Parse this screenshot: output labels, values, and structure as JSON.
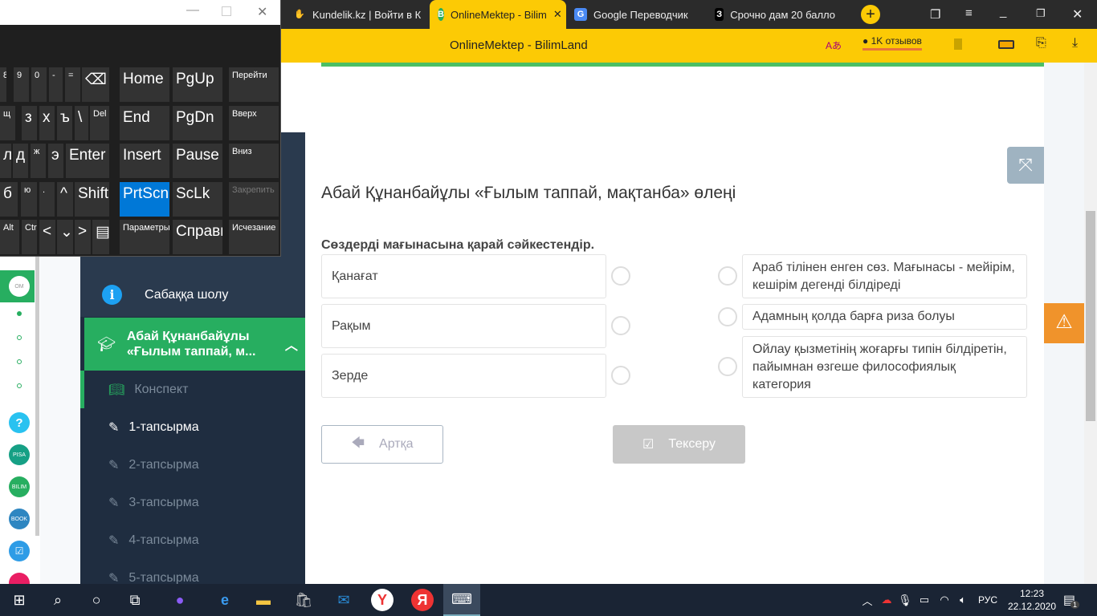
{
  "keyboard": {
    "row1": [
      "8",
      "9",
      "0",
      "-",
      "="
    ],
    "row2": [
      "щ",
      "з",
      "х",
      "ъ",
      "\\",
      "Del"
    ],
    "row3": [
      "л",
      "д",
      "ж",
      "э",
      "Enter"
    ],
    "row4": [
      "б",
      "ю",
      ".",
      "Shift"
    ],
    "row5": [
      "Alt",
      "Ctrl"
    ],
    "nav": [
      "Home",
      "PgUp",
      "Перейти",
      "End",
      "PgDn",
      "Вверх",
      "Insert",
      "Pause",
      "Вниз",
      "PrtScn",
      "ScLk",
      "Закрепить",
      "Параметры",
      "Справка",
      "Исчезание"
    ]
  },
  "browser": {
    "tabs": [
      {
        "label": "Kundelik.kz | Войти в К"
      },
      {
        "label": "OnlineMektep - Bilim"
      },
      {
        "label": "Google Переводчик"
      },
      {
        "label": "Срочно дам 20 балло"
      }
    ],
    "page_title": "OnlineMektep - BilimLand",
    "reviews": "1K отзывов"
  },
  "sidebar": {
    "overview": "Сабаққа шолу",
    "lesson": "Абай Құнанбайұлы «Ғылым таппай, м...",
    "items": [
      {
        "label": "Конспект"
      },
      {
        "label": "1-тапсырма"
      },
      {
        "label": "2-тапсырма"
      },
      {
        "label": "3-тапсырма"
      },
      {
        "label": "4-тапсырма"
      },
      {
        "label": "5-тапсырма"
      }
    ]
  },
  "main": {
    "title": "Абай Құнанбайұлы «Ғылым таппай, мақтанба» өлеңі",
    "instruction": "Сөздерді мағынасына қарай сәйкестендір.",
    "left": [
      "Қанағат",
      "Рақым",
      "Зерде"
    ],
    "right": [
      "Араб тілінен енген сөз. Мағынасы - мейірім, кешірім дегенді білдіреді",
      "Адамның қолда барға риза болуы",
      "Ойлау қызметінің жоғарғы типін білдіретін, пайымнан өзгеше философиялық категория"
    ],
    "back": "Артқа",
    "check": "Тексеру"
  },
  "taskbar": {
    "lang": "РУС",
    "time": "12:23",
    "date": "22.12.2020",
    "notifications": "1"
  },
  "colors": {
    "green": "#27ae60",
    "navy": "#1f2d40",
    "yellow": "#fcca05",
    "warning": "#f0932b"
  }
}
